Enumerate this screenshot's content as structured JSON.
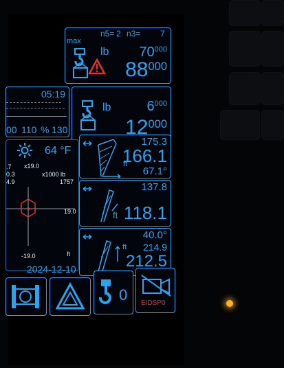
{
  "top_load": {
    "max_label": "max",
    "n5_label": "n5=",
    "n5_value": "2",
    "n3_label": "n3=",
    "n3_value": "7",
    "unit": "lb",
    "max_load_main": "70",
    "max_load_sup": "000",
    "actual_load_main": "88",
    "actual_load_sup": "000"
  },
  "aux_load": {
    "unit": "lb",
    "max_load_main": "6",
    "max_load_sup": "000",
    "actual_load_main": "12",
    "actual_load_sup": "000"
  },
  "status": {
    "time": "05:19",
    "percent_scale": [
      "00",
      "110",
      "%",
      "130"
    ]
  },
  "environment": {
    "temperature": "64 °F",
    "x_prefix": "x",
    "x_value": "19.0",
    "load_scale": "x1000 lb",
    "load_value": "1757",
    "left_values": [
      ".7",
      "0.3",
      "4.9"
    ],
    "chart_tick_right": "19.0",
    "chart_tick_left": "-19.0",
    "unit_ft": "ft",
    "date": "2024-12-10"
  },
  "boom_1": {
    "value_top": "175.3",
    "value_main": "166.1",
    "unit": "ft",
    "angle": "67.1°"
  },
  "boom_2": {
    "value_top": "137.8",
    "value_main": "118.1",
    "unit": "ft"
  },
  "boom_3": {
    "angle": "40.0°",
    "unit": "ft",
    "value_mid": "214.9",
    "value_main": "212.5"
  },
  "bottom_bar": {
    "hook_count": "0",
    "sensor_label": "EIDSP0"
  },
  "colors": {
    "accent": "#2aa4f0",
    "warning": "#e5322b",
    "background": "#02060c"
  }
}
